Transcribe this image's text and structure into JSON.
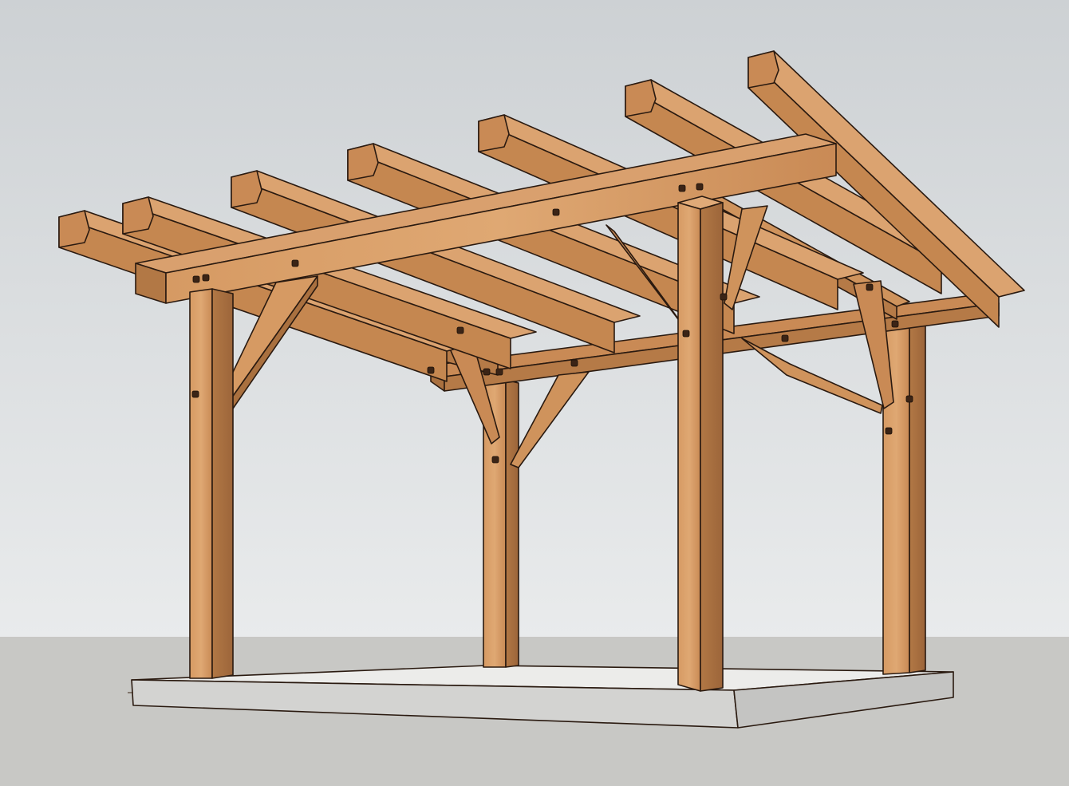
{
  "scene": {
    "subject": "timber-frame-pergola",
    "colors": {
      "sky_top": "#cfd3d6",
      "sky_bottom": "#e6e8ea",
      "ground": "#c9c9c6",
      "slab_top": "#ebebe9",
      "slab_side": "#d2d2d0",
      "wood_light": "#d9a06e",
      "wood_mid": "#c98a55",
      "wood_dark": "#a9703f",
      "wood_shade": "#8e5a30",
      "peg": "#3b2416"
    }
  }
}
